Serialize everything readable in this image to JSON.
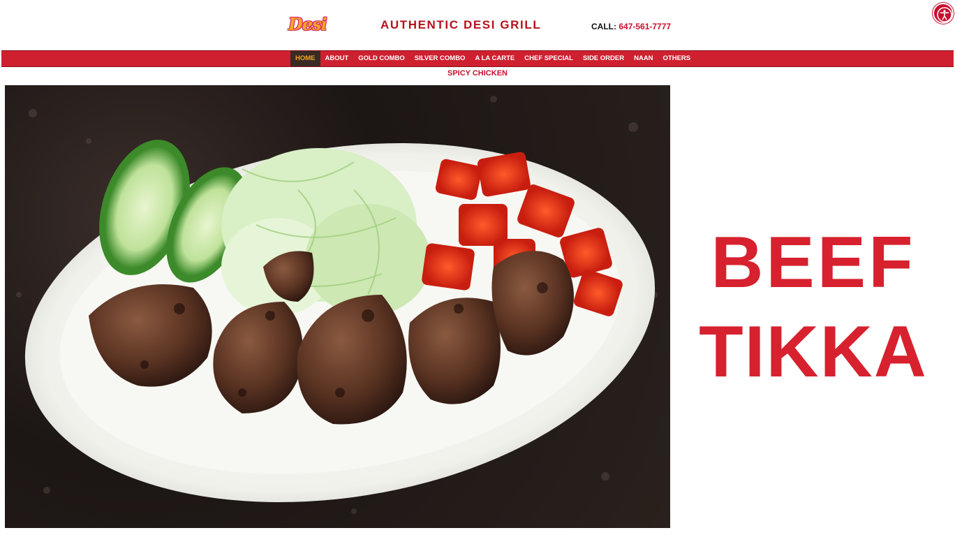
{
  "header": {
    "logo_text": "Desi",
    "site_title": "AUTHENTIC DESI GRILL",
    "call_label": "CALL:",
    "phone": "647-561-7777"
  },
  "nav": {
    "items": [
      {
        "label": "HOME",
        "active": true
      },
      {
        "label": "ABOUT",
        "active": false
      },
      {
        "label": "GOLD COMBO",
        "active": false
      },
      {
        "label": "SILVER COMBO",
        "active": false
      },
      {
        "label": "A LA CARTE",
        "active": false
      },
      {
        "label": "CHEF SPECIAL",
        "active": false
      },
      {
        "label": "SIDE ORDER",
        "active": false
      },
      {
        "label": "NAAN",
        "active": false
      },
      {
        "label": "OTHERS",
        "active": false
      }
    ]
  },
  "submenu_label": "SPICY CHICKEN",
  "dish": {
    "line1": "BEEF",
    "line2": "TIKKA"
  },
  "icons": {
    "accessibility": "accessibility-icon"
  },
  "colors": {
    "brand_red": "#cf2030",
    "title_red": "#b5121b",
    "headline_red": "#d7212e",
    "nav_active_bg": "#3a2a24",
    "nav_active_text": "#f5a623"
  }
}
